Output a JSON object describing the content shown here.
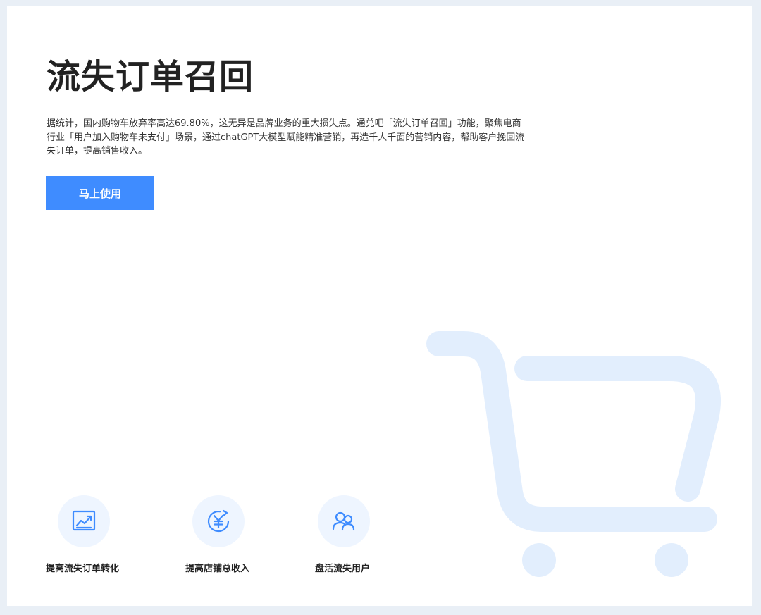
{
  "hero": {
    "title": "流失订单召回",
    "description": "据统计，国内购物车放弃率高达69.80%，这无异是品牌业务的重大损失点。通兑吧「流失订单召回」功能，聚焦电商行业「用户加入购物车未支付」场景，通过chatGPT大模型赋能精准营销，再造千人千面的营销内容，帮助客户挽回流失订单，提高销售收入。",
    "cta_label": "马上使用"
  },
  "features": [
    {
      "label": "提高流失订单转化",
      "icon": "trend-chart-icon"
    },
    {
      "label": "提高店铺总收入",
      "icon": "yuan-refresh-icon"
    },
    {
      "label": "盘活流失用户",
      "icon": "users-icon"
    }
  ],
  "colors": {
    "accent": "#3f8cff",
    "icon_stroke": "#3f8cff",
    "icon_bg": "#eef5ff",
    "cart_illustration": "#e2eefd",
    "page_bg": "#e9eff6"
  }
}
